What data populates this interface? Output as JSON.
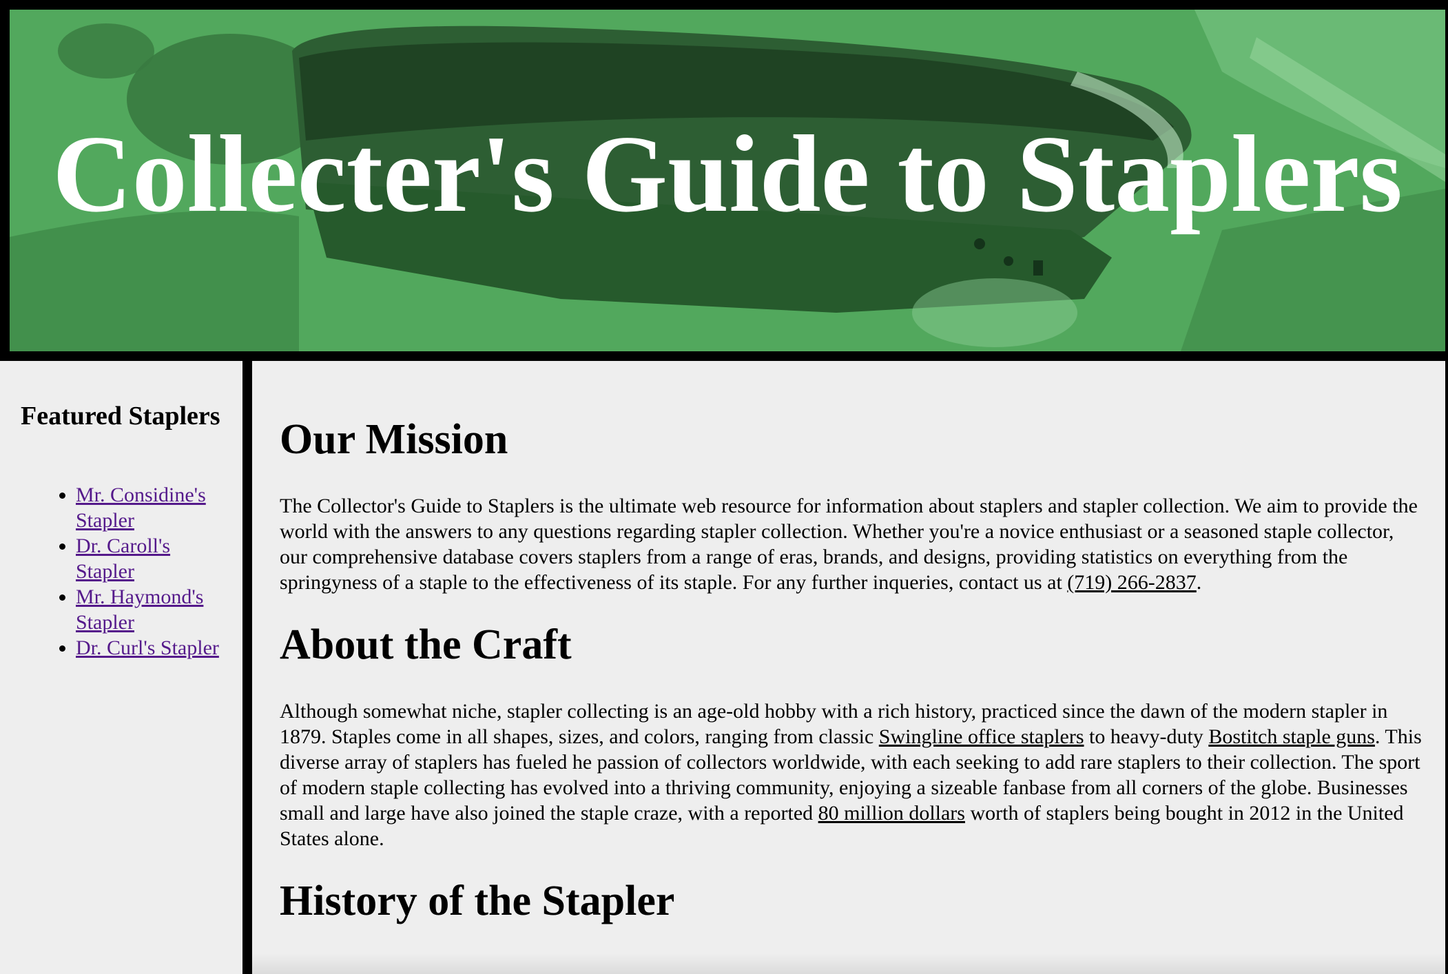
{
  "header": {
    "title": "Collecter's Guide to Staplers"
  },
  "sidebar": {
    "title": "Featured Staplers",
    "items": [
      {
        "label": "Mr. Considine's Stapler"
      },
      {
        "label": "Dr. Caroll's Stapler"
      },
      {
        "label": "Mr. Haymond's Stapler"
      },
      {
        "label": "Dr. Curl's Stapler"
      }
    ]
  },
  "main": {
    "mission": {
      "heading": "Our Mission",
      "text_before_link": "The Collector's Guide to Staplers is the ultimate web resource for information about staplers and stapler collection. We aim to provide the world with the answers to any questions regarding stapler collection. Whether you're a novice enthusiast or a seasoned staple collector, our comprehensive database covers staplers from a range of eras, brands, and designs, providing statistics on everything from the springyness of a staple to the effectiveness of its staple. For any further inqueries, contact us at ",
      "phone_link": "(719) 266-2837",
      "text_after_link": "."
    },
    "craft": {
      "heading": "About the Craft",
      "text_1": "Although somewhat niche, stapler collecting is an age-old hobby with a rich history, practiced since the dawn of the modern stapler in 1879. Staples come in all shapes, sizes, and colors, ranging from classic ",
      "link_1": "Swingline office staplers",
      "text_2": " to heavy-duty ",
      "link_2": "Bostitch staple guns",
      "text_3": ". This diverse array of staplers has fueled he passion of collectors worldwide, with each seeking to add rare staplers to their collection. The sport of modern staple collecting has evolved into a thriving community, enjoying a sizeable fanbase from all corners of the globe. Businesses small and large have also joined the staple craze, with a reported ",
      "link_3": "80 million dollars",
      "text_4": " worth of staplers being bought in 2012 in the United States alone."
    },
    "history": {
      "heading": "History of the Stapler"
    }
  },
  "colors": {
    "banner_green": "#4fa55a",
    "background": "#eeeeee",
    "border": "#000000",
    "visited_link": "#551a8b"
  }
}
